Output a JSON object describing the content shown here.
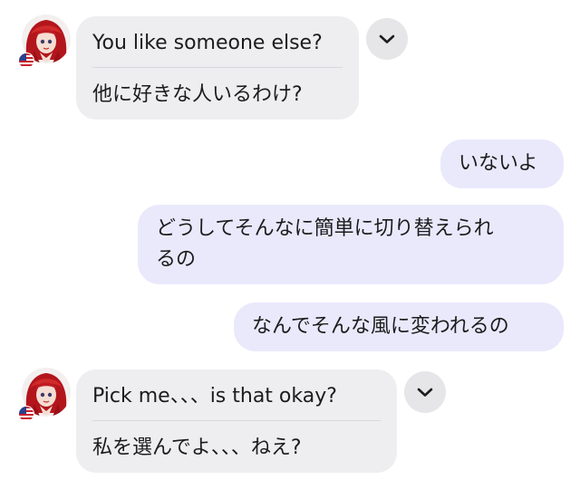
{
  "messages": [
    {
      "direction": "incoming",
      "original": "You like someone else?",
      "translation": "他に好きな人いるわけ?"
    },
    {
      "direction": "outgoing",
      "text": "いないよ"
    },
    {
      "direction": "outgoing",
      "text": "どうしてそんなに簡単に切り替えられるの",
      "line1": "どうしてそんなに簡単に切り替えられ",
      "line2": "るの"
    },
    {
      "direction": "outgoing",
      "text": "なんでそんな風に変われるの"
    },
    {
      "direction": "incoming",
      "original": "Pick me、、、is that okay?",
      "translation": "私を選んでよ、、、ねえ?"
    }
  ],
  "icons": {
    "expand": "chevron-down-icon",
    "flag": "us-flag-icon"
  },
  "colors": {
    "incoming_bubble": "#eeeef0",
    "outgoing_bubble": "#eae9fb",
    "divider": "#d8d8dc",
    "chevron_button": "#e6e6e8"
  }
}
